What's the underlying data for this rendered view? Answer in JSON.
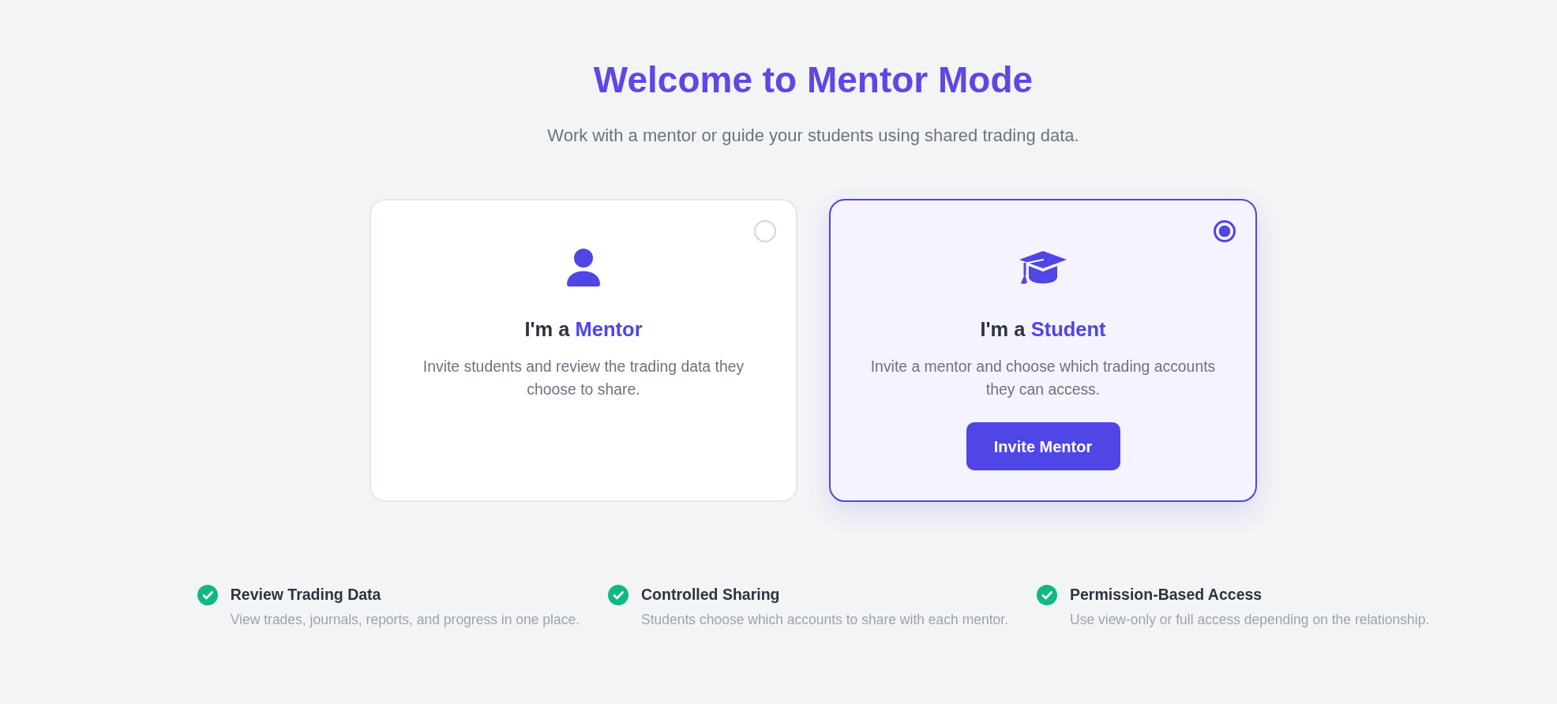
{
  "header": {
    "title": "Welcome to Mentor Mode",
    "subtitle": "Work with a mentor or guide your students using shared trading data."
  },
  "roles": [
    {
      "kind": "mentor",
      "selected": false,
      "title_prefix": "I'm a",
      "title_accent": "Mentor",
      "description": "Invite students and review the trading data they choose to share."
    },
    {
      "kind": "student",
      "selected": true,
      "title_prefix": "I'm a",
      "title_accent": "Student",
      "description": "Invite a mentor and choose which trading accounts they can access.",
      "button": "Invite Mentor"
    }
  ],
  "features": [
    {
      "title": "Review Trading Data",
      "description": "View trades, journals, reports, and progress in one place."
    },
    {
      "title": "Controlled Sharing",
      "description": "Students choose which accounts to share with each mentor."
    },
    {
      "title": "Permission-Based Access",
      "description": "Use view-only or full access depending on the relationship."
    }
  ]
}
